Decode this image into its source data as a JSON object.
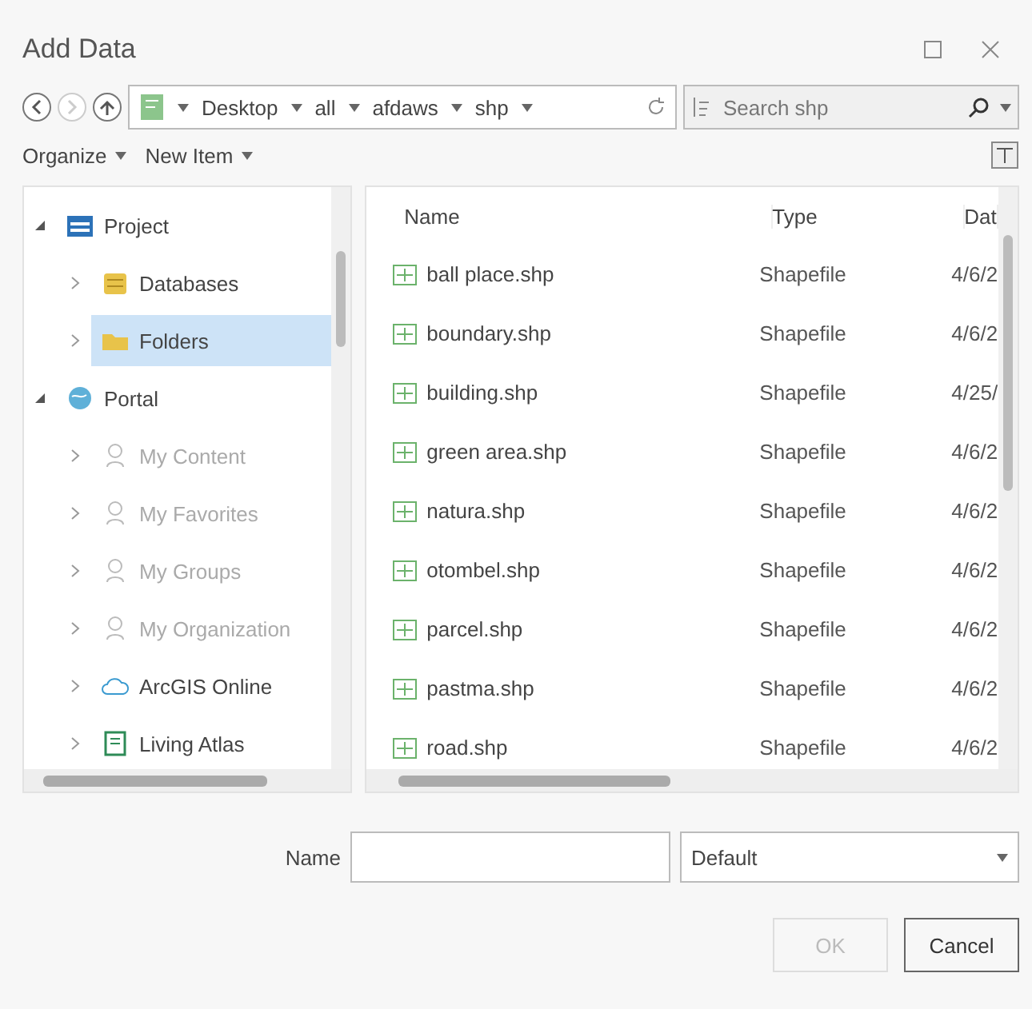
{
  "window": {
    "title": "Add Data"
  },
  "breadcrumb": [
    "Desktop",
    "all",
    "afdaws",
    "shp"
  ],
  "search": {
    "placeholder": "Search shp"
  },
  "toolbar": [
    "Organize",
    "New Item"
  ],
  "tree": [
    {
      "label": "Project",
      "kind": "project",
      "expanded": true,
      "selected": false,
      "disabled": false,
      "children": [
        {
          "label": "Databases",
          "kind": "database",
          "expanded": false,
          "selected": false,
          "disabled": false
        },
        {
          "label": "Folders",
          "kind": "folder",
          "expanded": false,
          "selected": true,
          "disabled": false
        }
      ]
    },
    {
      "label": "Portal",
      "kind": "portal",
      "expanded": true,
      "selected": false,
      "disabled": false,
      "children": [
        {
          "label": "My Content",
          "kind": "user",
          "expanded": false,
          "selected": false,
          "disabled": true
        },
        {
          "label": "My Favorites",
          "kind": "user",
          "expanded": false,
          "selected": false,
          "disabled": true
        },
        {
          "label": "My Groups",
          "kind": "user",
          "expanded": false,
          "selected": false,
          "disabled": true
        },
        {
          "label": "My Organization",
          "kind": "user",
          "expanded": false,
          "selected": false,
          "disabled": true
        },
        {
          "label": "ArcGIS Online",
          "kind": "cloud",
          "expanded": false,
          "selected": false,
          "disabled": false
        },
        {
          "label": "Living Atlas",
          "kind": "atlas",
          "expanded": false,
          "selected": false,
          "disabled": false
        }
      ]
    }
  ],
  "table": {
    "columns": [
      "Name",
      "Type",
      "Dat"
    ],
    "rows": [
      {
        "name": "ball place.shp",
        "type": "Shapefile",
        "date": "4/6/2"
      },
      {
        "name": "boundary.shp",
        "type": "Shapefile",
        "date": "4/6/2"
      },
      {
        "name": "building.shp",
        "type": "Shapefile",
        "date": "4/25/"
      },
      {
        "name": "green area.shp",
        "type": "Shapefile",
        "date": "4/6/2"
      },
      {
        "name": "natura.shp",
        "type": "Shapefile",
        "date": "4/6/2"
      },
      {
        "name": "otombel.shp",
        "type": "Shapefile",
        "date": "4/6/2"
      },
      {
        "name": "parcel.shp",
        "type": "Shapefile",
        "date": "4/6/2"
      },
      {
        "name": "pastma.shp",
        "type": "Shapefile",
        "date": "4/6/2"
      },
      {
        "name": "road.shp",
        "type": "Shapefile",
        "date": "4/6/2"
      }
    ]
  },
  "name_field": {
    "label": "Name",
    "filter": "Default"
  },
  "buttons": [
    {
      "label": "OK",
      "disabled": true
    },
    {
      "label": "Cancel",
      "disabled": false
    }
  ]
}
